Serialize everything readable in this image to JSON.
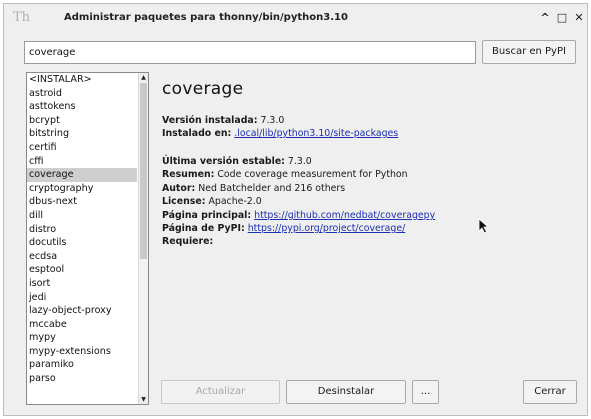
{
  "window": {
    "title": "Administrar paquetes para thonny/bin/python3.10",
    "controls": {
      "maximize": "^",
      "restore": "□",
      "close": "✕"
    }
  },
  "search": {
    "value": "coverage",
    "button_label": "Buscar en PyPI"
  },
  "packages": {
    "items": [
      "<INSTALAR>",
      "astroid",
      "asttokens",
      "bcrypt",
      "bitstring",
      "certifi",
      "cffi",
      "coverage",
      "cryptography",
      "dbus-next",
      "dill",
      "distro",
      "docutils",
      "ecdsa",
      "esptool",
      "isort",
      "jedi",
      "lazy-object-proxy",
      "mccabe",
      "mypy",
      "mypy-extensions",
      "paramiko",
      "parso"
    ],
    "selected": "coverage"
  },
  "details": {
    "name": "coverage",
    "installed_version_label": "Versión instalada:",
    "installed_version": "7.3.0",
    "installed_at_label": "Instalado en:",
    "installed_at": ".local/lib/python3.10/site-packages",
    "latest_label": "Última versión estable:",
    "latest": "7.3.0",
    "summary_label": "Resumen:",
    "summary": "Code coverage measurement for Python",
    "author_label": "Autor:",
    "author": "Ned Batchelder and 216 others",
    "license_label": "License:",
    "license": "Apache-2.0",
    "homepage_label": "Página principal:",
    "homepage": "https://github.com/nedbat/coveragepy",
    "pypi_label": "Página de PyPI:",
    "pypi": "https://pypi.org/project/coverage/",
    "requires_label": "Requiere:"
  },
  "buttons": {
    "update": "Actualizar",
    "uninstall": "Desinstalar",
    "more": "...",
    "close": "Cerrar"
  }
}
